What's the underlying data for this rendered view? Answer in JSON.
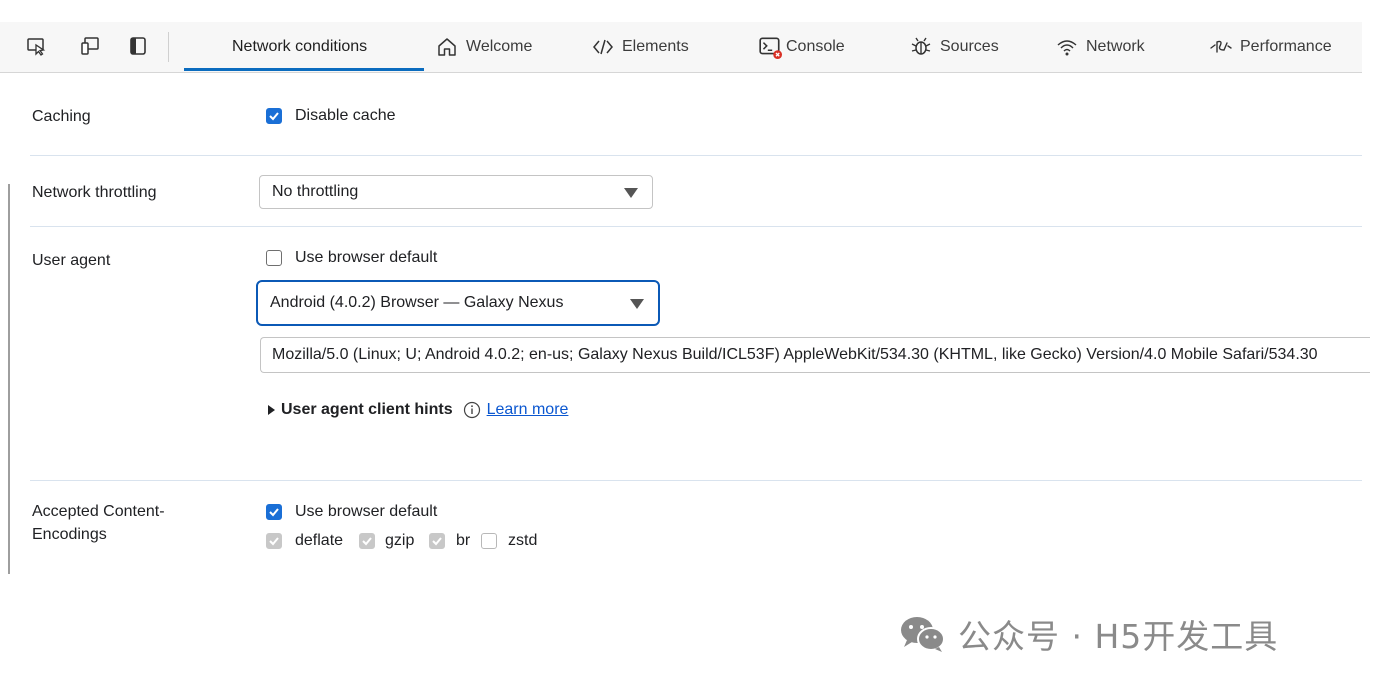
{
  "tabs": [
    {
      "label": "Network conditions",
      "icon": "none",
      "active": true
    },
    {
      "label": "Welcome",
      "icon": "home-icon",
      "active": false
    },
    {
      "label": "Elements",
      "icon": "code-brackets-icon",
      "active": false
    },
    {
      "label": "Console",
      "icon": "console-icon",
      "active": false
    },
    {
      "label": "Sources",
      "icon": "bug-icon",
      "active": false
    },
    {
      "label": "Network",
      "icon": "wifi-icon",
      "active": false
    },
    {
      "label": "Performance",
      "icon": "performance-icon",
      "active": false
    }
  ],
  "caching": {
    "label": "Caching",
    "disable_cache_label": "Disable cache",
    "disable_cache_checked": true
  },
  "throttling": {
    "label": "Network throttling",
    "selected": "No throttling"
  },
  "user_agent": {
    "label": "User agent",
    "use_default_label": "Use browser default",
    "use_default_checked": false,
    "selected": "Android (4.0.2) Browser — Galaxy Nexus",
    "string": "Mozilla/5.0 (Linux; U; Android 4.0.2; en-us; Galaxy Nexus Build/ICL53F) AppleWebKit/534.30 (KHTML, like Gecko) Version/4.0 Mobile Safari/534.30",
    "hints_label": "User agent client hints",
    "learn_more": "Learn more"
  },
  "encodings": {
    "label_line1": "Accepted Content-",
    "label_line2": "Encodings",
    "use_default_label": "Use browser default",
    "use_default_checked": true,
    "items": [
      {
        "label": "deflate",
        "checked": true
      },
      {
        "label": "gzip",
        "checked": true
      },
      {
        "label": "br",
        "checked": true
      },
      {
        "label": "zstd",
        "checked": false
      }
    ]
  },
  "watermark": {
    "text": "公众号 · H5开发工具",
    "icon": "wechat-icon"
  },
  "colors": {
    "accent": "#0b6cbf",
    "checkbox": "#1a6fd6",
    "link": "#0b57d0",
    "focus_border": "#0b59b6"
  }
}
